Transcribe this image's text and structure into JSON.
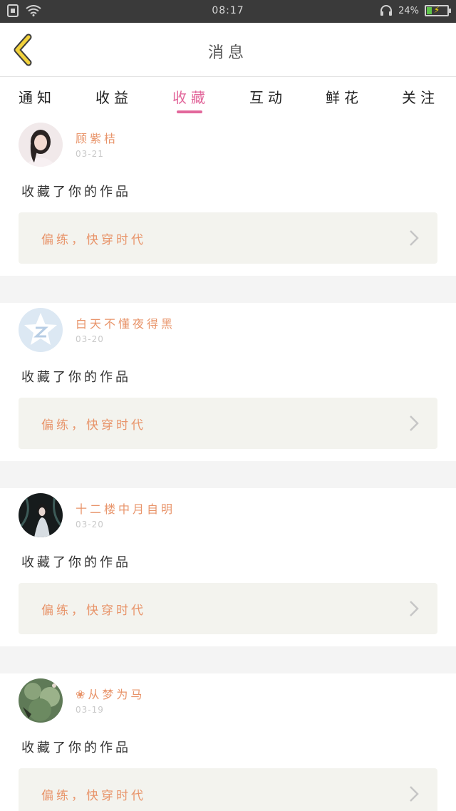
{
  "status_bar": {
    "time": "08:17",
    "battery_pct": "24%",
    "battery_level": 0.24
  },
  "header": {
    "title": "消息"
  },
  "tabs": [
    {
      "label": "通知"
    },
    {
      "label": "收益"
    },
    {
      "label": "收藏"
    },
    {
      "label": "互动"
    },
    {
      "label": "鲜花"
    },
    {
      "label": "关注"
    }
  ],
  "active_tab": "收藏",
  "colors": {
    "accent": "#e2679b",
    "name": "#e8946a",
    "work_bg": "#f3f3ee"
  },
  "items": [
    {
      "username": "顾紫桔",
      "date": "03-21",
      "action": "收藏了你的作品",
      "work_title": "偏练，快穿时代"
    },
    {
      "username": "白天不懂夜得黑",
      "date": "03-20",
      "action": "收藏了你的作品",
      "work_title": "偏练，快穿时代"
    },
    {
      "username": "十二楼中月自明",
      "date": "03-20",
      "action": "收藏了你的作品",
      "work_title": "偏练，快穿时代"
    },
    {
      "username": "❀从梦为马",
      "date": "03-19",
      "action": "收藏了你的作品",
      "work_title": "偏练，快穿时代"
    }
  ]
}
